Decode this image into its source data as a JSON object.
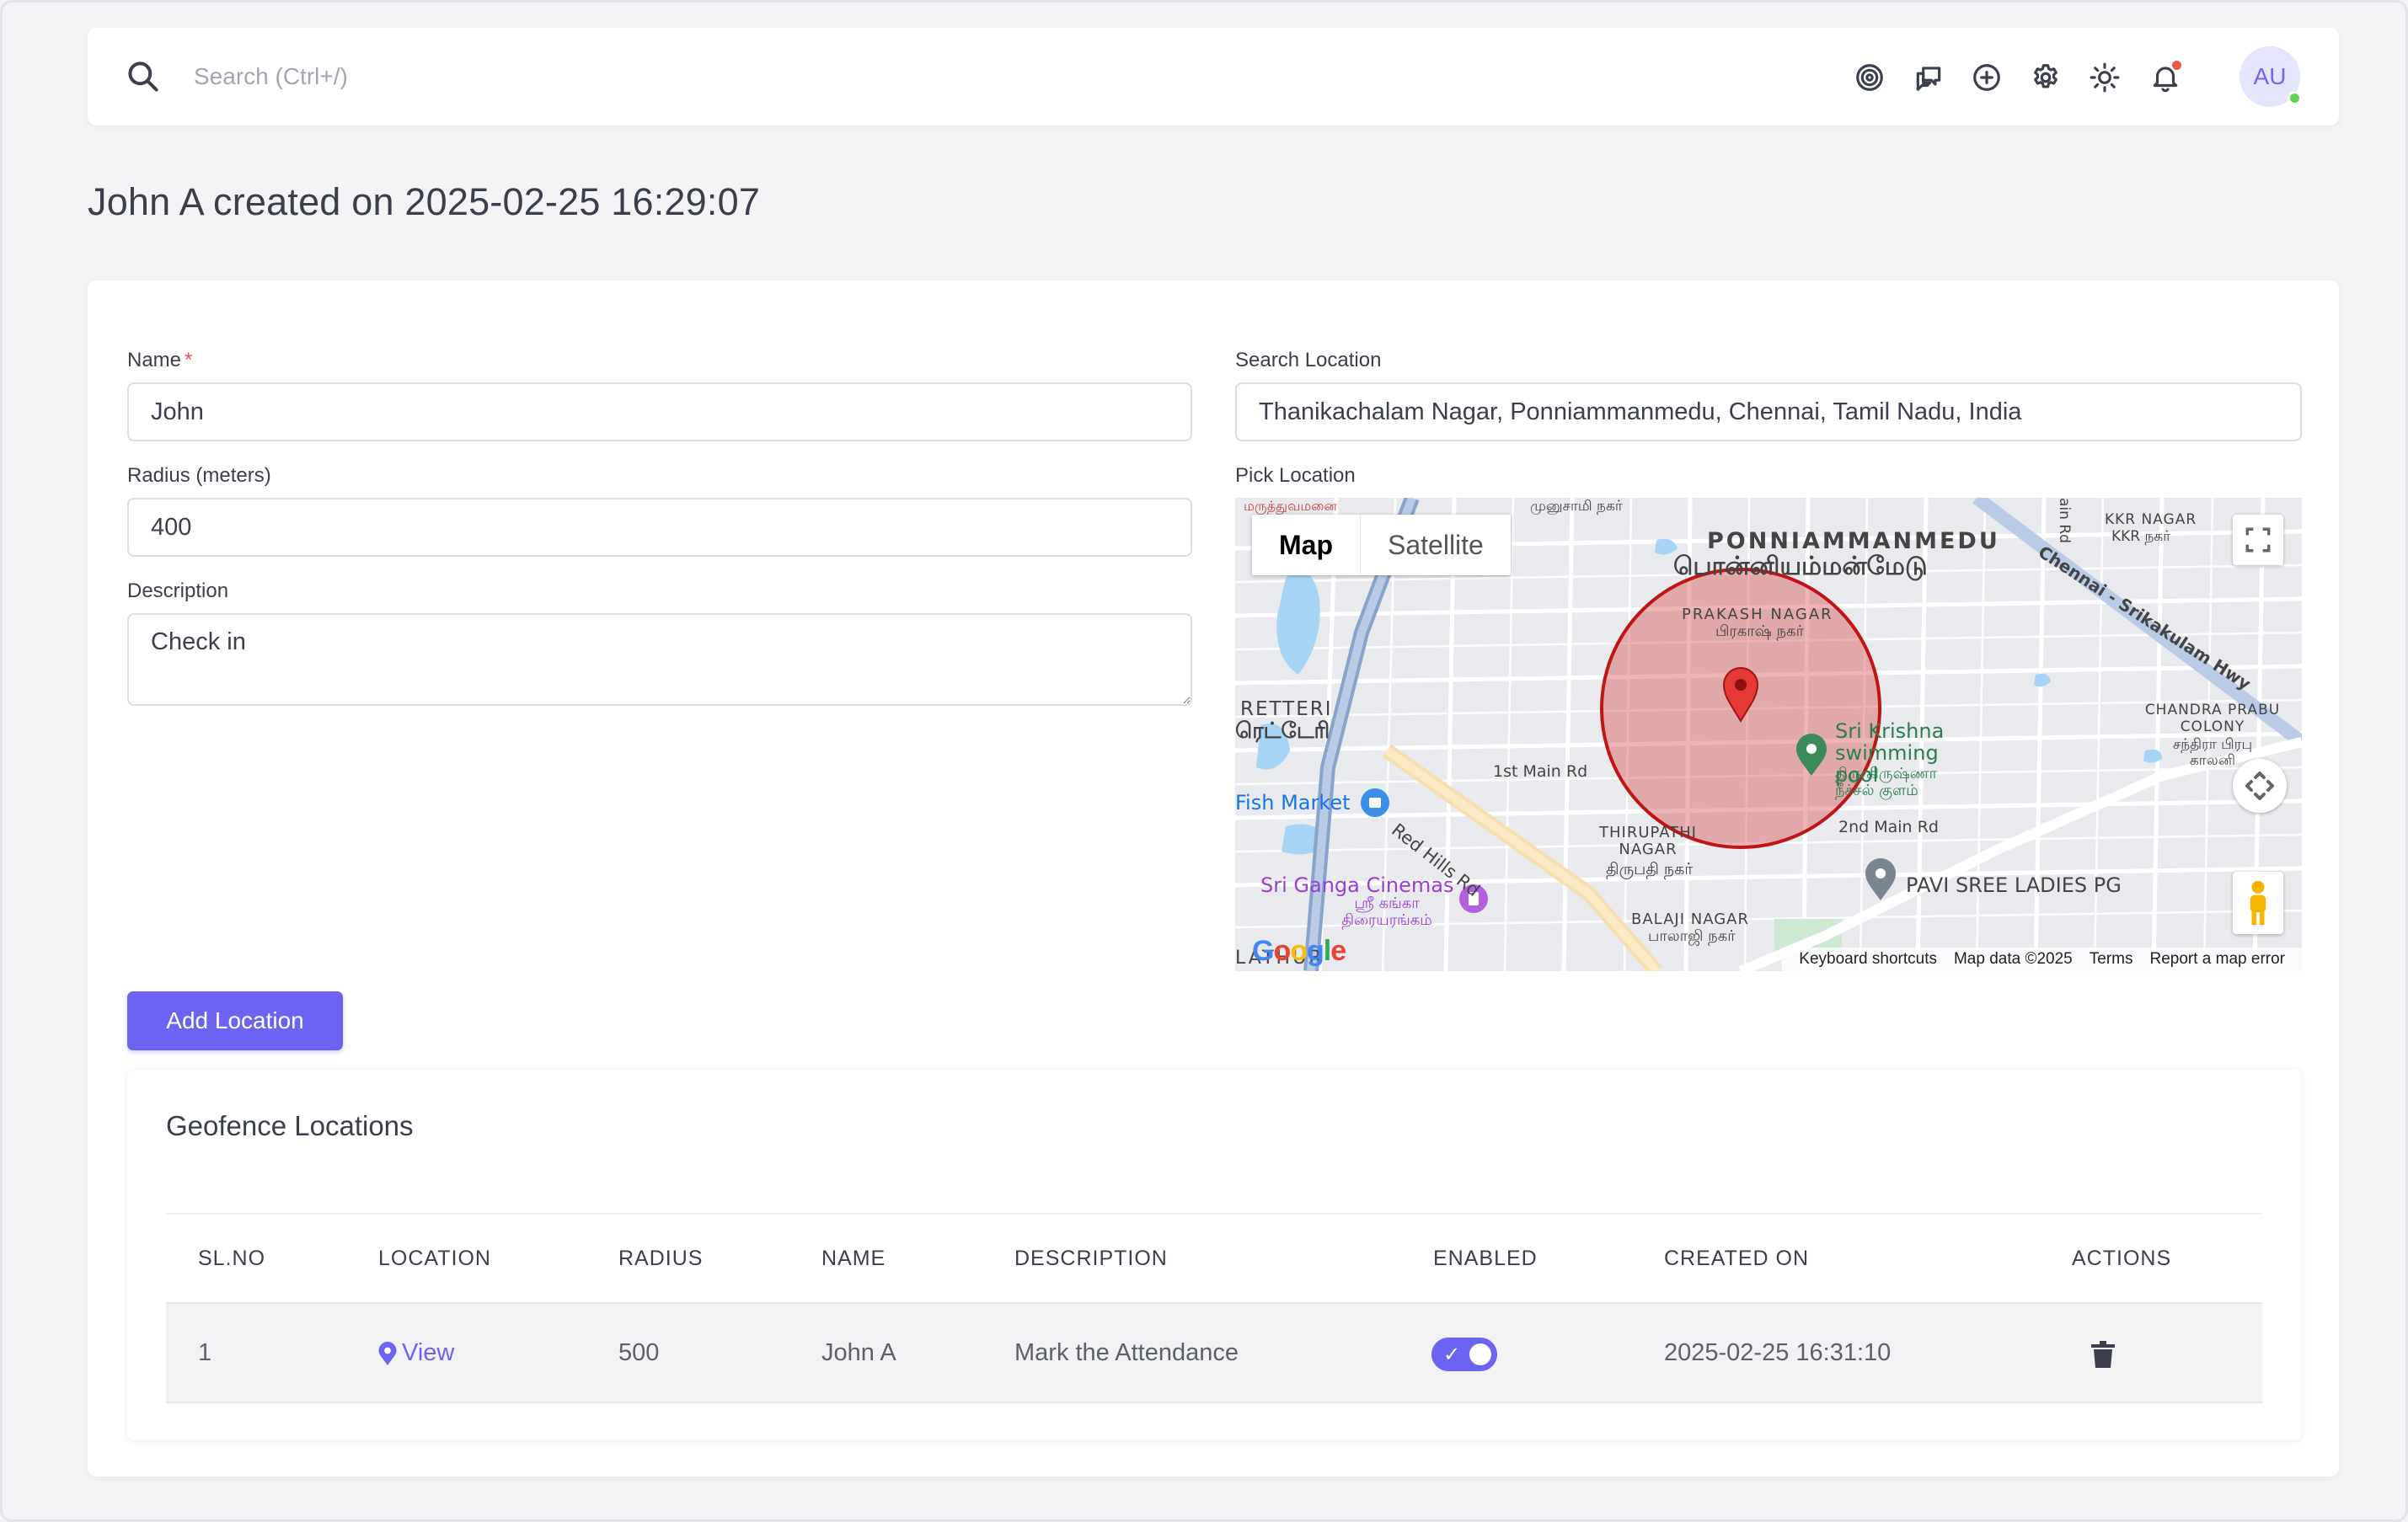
{
  "topbar": {
    "search_placeholder": "Search (Ctrl+/)",
    "icons": [
      "target-icon",
      "chat-icon",
      "plus-circle-icon",
      "gear-icon",
      "sun-icon",
      "bell-icon"
    ],
    "avatar_initials": "AU"
  },
  "page": {
    "title": "John A created on 2025-02-25 16:29:07"
  },
  "form": {
    "name_label": "Name",
    "name_required_mark": "*",
    "name_value": "John",
    "radius_label": "Radius (meters)",
    "radius_value": "400",
    "description_label": "Description",
    "description_value": "Check in",
    "search_location_label": "Search Location",
    "search_location_value": "Thanikachalam Nagar, Ponniammanmedu, Chennai, Tamil Nadu, India",
    "pick_location_label": "Pick Location",
    "add_button": "Add Location"
  },
  "map": {
    "map_tab": "Map",
    "satellite_tab": "Satellite",
    "labels": {
      "ponniammanmedu": "PONNIAMMANMEDU",
      "ponniammanmedu_ta": "பொன்னியம்மன்மேடு",
      "prakash_nagar": "PRAKASH NAGAR",
      "prakash_nagar_ta": "பிரகாஷ் நகர்",
      "retteri": "RETTERI",
      "retteri_ta": "ரெட்டேரி",
      "fish_market": "Fish Market",
      "first_main_rd": "1st Main Rd",
      "red_hills_rd": "Red Hills Rd",
      "sri_krishna": "Sri Krishna swimming pool",
      "sri_krishna_ta": "திரு கிருஷ்ணா நீச்சல் குளம்",
      "second_main_rd": "2nd Main Rd",
      "thirupathi_nagar": "THIRUPATHI NAGAR",
      "thirupathi_nagar_ta": "திருபதி நகர்",
      "sri_ganga": "Sri Ganga Cinemas",
      "sri_ganga_ta": "ஸ்ரீ கங்கா திரையரங்கம்",
      "pavi_sree": "PAVI SREE LADIES PG",
      "balaji_nagar": "BALAJI NAGAR",
      "balaji_nagar_ta": "பாலாஜி நகர்",
      "kkr_nagar": "KKR NAGAR",
      "kkr_nagar_ta": "KKR நகர்",
      "chandra_prabu": "CHANDRA PRABU COLONY",
      "chandra_prabu_ta": "சந்திரா பிரபு காலனி",
      "highway": "Chennai - Srikakulam Hwy",
      "muthu": "முனுசாமி நகர்",
      "hospital": "மருத்துவமனை",
      "lathur": "LATHUR",
      "main_rd": "ain Rd"
    },
    "footer": {
      "shortcuts": "Keyboard shortcuts",
      "data": "Map data ©2025",
      "terms": "Terms",
      "report": "Report a map error"
    },
    "logo": "Google"
  },
  "geofence": {
    "title": "Geofence Locations",
    "columns": [
      "SL.NO",
      "LOCATION",
      "RADIUS",
      "NAME",
      "DESCRIPTION",
      "ENABLED",
      "CREATED ON",
      "ACTIONS"
    ],
    "rows": [
      {
        "sl_no": "1",
        "location": "View",
        "radius": "500",
        "name": "John A",
        "description": "Mark the Attendance",
        "enabled": true,
        "created_on": "2025-02-25 16:31:10"
      }
    ]
  }
}
